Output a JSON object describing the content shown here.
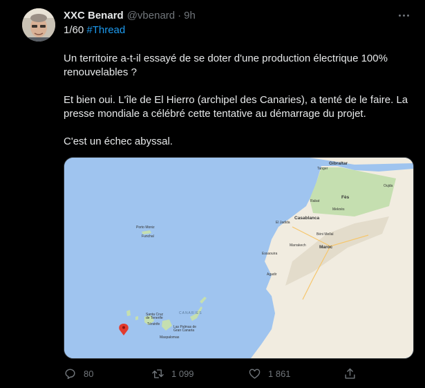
{
  "tweet": {
    "author_name": "XXC Benard",
    "author_handle": "@vbenard",
    "separator": "·",
    "time": "9h",
    "thread_counter": "1/60",
    "hashtag": "#Thread",
    "paragraphs": [
      "Un territoire a-t-il essayé de se doter d'une production électrique 100% renouvelables ?",
      "Et bien oui. L'île de El Hierro (archipel des Canaries), a tenté de le faire. La presse mondiale a célébré cette tentative au démarrage du projet.",
      "C'est un échec abyssal."
    ]
  },
  "map": {
    "labels": {
      "gibraltar": "Gibraltar",
      "tanger": "Tanger",
      "fes": "Fès",
      "rabat": "Rabat",
      "meknes": "Meknès",
      "oujda": "Oujda",
      "el_jadida": "El Jadida",
      "casablanca": "Casablanca",
      "marrakech": "Marrakech",
      "beni_mellal": "Béni Mellal",
      "maroc": "Maroc",
      "porto_moniz": "Porto Moniz",
      "funchal": "Funchal",
      "essaouira": "Essaouira",
      "agadir": "Agadir",
      "santa_cruz": "Santa Cruz de Tenerife",
      "tenerife": "Ténérife",
      "canaries": "CANARIES",
      "las_palmas": "Las Palmas de Gran Canaria",
      "maspalomas": "Maspalomas"
    },
    "colors": {
      "ocean": "#9fc4ef",
      "land": "#f1ece0",
      "green": "#c5dfb0",
      "pin": "#e23b2e"
    }
  },
  "actions": {
    "replies": "80",
    "retweets": "1 099",
    "likes": "1 861"
  }
}
